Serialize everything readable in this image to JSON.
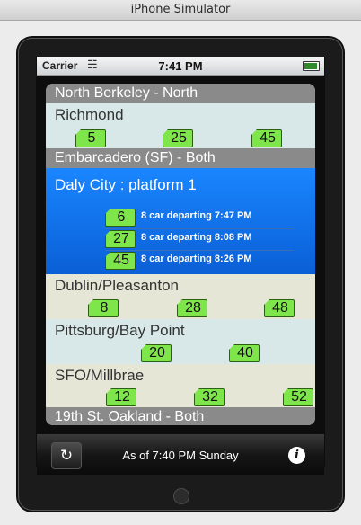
{
  "window": {
    "title": "iPhone Simulator"
  },
  "status_bar": {
    "carrier": "Carrier",
    "wifi_icon": "wifi-icon",
    "time": "7:41 PM",
    "battery_level": 0.9
  },
  "sections": [
    {
      "header": "North Berkeley - North",
      "rows": [
        {
          "destination": "Richmond",
          "minutes": [
            "5",
            "25",
            "45"
          ]
        }
      ]
    },
    {
      "header": "Embarcadero (SF) - Both",
      "selected": {
        "destination": "Daly City : platform 1",
        "departures": [
          {
            "minutes": "6",
            "text": "8 car departing 7:47 PM"
          },
          {
            "minutes": "27",
            "text": "8 car departing 8:08 PM"
          },
          {
            "minutes": "45",
            "text": "8 car departing 8:26 PM"
          }
        ]
      },
      "rows": [
        {
          "destination": "Dublin/Pleasanton",
          "minutes": [
            "8",
            "28",
            "48"
          ]
        },
        {
          "destination": "Pittsburg/Bay Point",
          "minutes": [
            "20",
            "40"
          ]
        },
        {
          "destination": "SFO/Millbrae",
          "minutes": [
            "12",
            "32",
            "52"
          ]
        }
      ]
    },
    {
      "header": "19th St. Oakland - Both"
    }
  ],
  "toolbar": {
    "refresh_icon": "refresh-icon",
    "as_of": "As of 7:40 PM Sunday",
    "info_icon": "info-icon"
  },
  "colors": {
    "badge": "#7ee64b",
    "selected_row": "#1a86ff",
    "header": "#8a8a8a",
    "row_a": "#d8e7e7",
    "row_b": "#e6e6d6"
  }
}
